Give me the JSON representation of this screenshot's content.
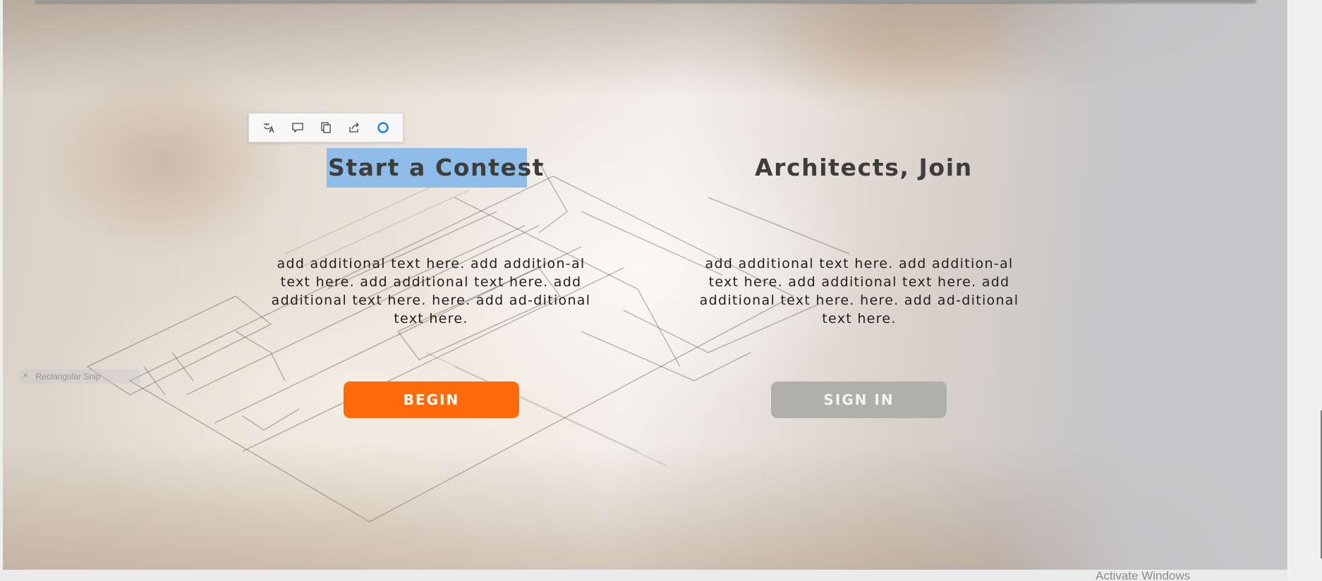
{
  "toolbar": {
    "icons": [
      "translate-icon",
      "comment-icon",
      "copy-icon",
      "share-icon",
      "circle-icon"
    ],
    "accent": "#1a7fd6"
  },
  "left": {
    "heading": "Start a Contest",
    "body": "add additional text here. add addition-al text here. add additional text here. add additional text here. here. add ad-ditional text here.",
    "button": "BEGIN",
    "button_color": "#ff6a0a"
  },
  "right": {
    "heading": "Architects, Join",
    "body": "add additional text here. add addition-al text here. add additional text here. add additional text here. here. add ad-ditional text here.",
    "button": "SIGN IN",
    "button_color": "#afafac"
  },
  "ghost_label": "Rectangular Snip",
  "watermark": "Activate Windows",
  "selection_color": "#8fbde9"
}
